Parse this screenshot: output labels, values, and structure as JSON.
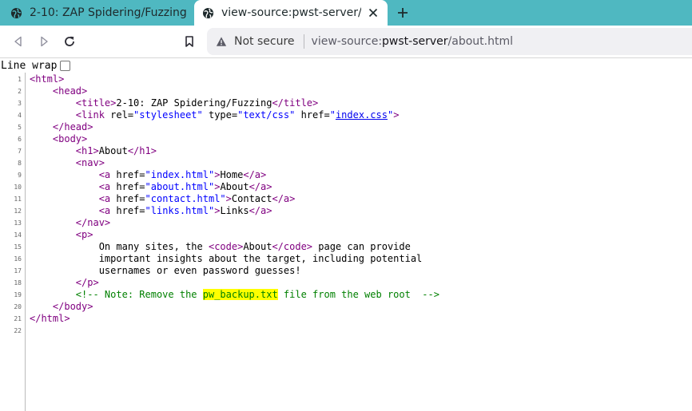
{
  "tabs": [
    {
      "title": "2-10: ZAP Spidering/Fuzzing",
      "active": false,
      "favicon": "globe-icon"
    },
    {
      "title": "view-source:pwst-server/about.html",
      "active": true,
      "favicon": "globe-icon"
    }
  ],
  "new_tab_icon": "plus-icon",
  "toolbar": {
    "back_icon": "back-arrow-icon",
    "forward_icon": "forward-arrow-icon",
    "reload_icon": "reload-icon",
    "bookmark_icon": "bookmark-icon",
    "security_label": "Not secure",
    "url": {
      "scheme": "view-source:",
      "host": "pwst-server",
      "path": "/about.html"
    }
  },
  "line_wrap": {
    "label": "Line wrap",
    "checked": false
  },
  "source": {
    "line_numbers": [
      "1",
      "2",
      "3",
      "4",
      "5",
      "6",
      "7",
      "8",
      "9",
      "10",
      "11",
      "12",
      "13",
      "14",
      "15",
      "16",
      "17",
      "18",
      "19",
      "20",
      "21",
      "22"
    ],
    "lines": {
      "l1": [
        "<html>"
      ],
      "l2": [
        "    ",
        "<head>"
      ],
      "l3": [
        "        ",
        "<title>",
        "2-10: ZAP Spidering/Fuzzing",
        "</title>"
      ],
      "l4": [
        "        ",
        "<link",
        " rel=",
        "\"stylesheet\"",
        " type=",
        "\"text/css\"",
        " href=",
        "\"",
        "index.css",
        "\"",
        ">"
      ],
      "l5": [
        "    ",
        "</head>"
      ],
      "l6": [
        "    ",
        "<body>"
      ],
      "l7": [
        "        ",
        "<h1>",
        "About",
        "</h1>"
      ],
      "l8": [
        "        ",
        "<nav>"
      ],
      "l9": [
        "            ",
        "<a",
        " href=",
        "\"index.html\"",
        ">",
        "Home",
        "</a>"
      ],
      "l10": [
        "            ",
        "<a",
        " href=",
        "\"about.html\"",
        ">",
        "About",
        "</a>"
      ],
      "l11": [
        "            ",
        "<a",
        " href=",
        "\"contact.html\"",
        ">",
        "Contact",
        "</a>"
      ],
      "l12": [
        "            ",
        "<a",
        " href=",
        "\"links.html\"",
        ">",
        "Links",
        "</a>"
      ],
      "l13": [
        "        ",
        "</nav>"
      ],
      "l14": [
        "        ",
        "<p>"
      ],
      "l15": [
        "            On many sites, the ",
        "<code>",
        "About",
        "</code>",
        " page can provide"
      ],
      "l16": [
        "            important insights about the target, including potential"
      ],
      "l17": [
        "            usernames or even password guesses!"
      ],
      "l18": [
        "        ",
        "</p>"
      ],
      "l19": [
        "        ",
        "<!-- Note: Remove the ",
        "pw_backup.txt",
        " file from the web root  -->"
      ],
      "l20": [
        "    ",
        "</body>"
      ],
      "l21": [
        "</html>"
      ],
      "l22": [
        ""
      ]
    }
  },
  "colors": {
    "tab_strip": "#4fb8c1",
    "tag": "#800080",
    "attribute_value": "#0000ff",
    "link": "#0000ee",
    "comment": "#008000",
    "highlight": "#ffff00"
  }
}
